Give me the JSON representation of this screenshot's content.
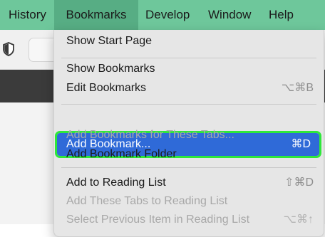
{
  "menubar": {
    "items": [
      {
        "label": "History"
      },
      {
        "label": "Bookmarks"
      },
      {
        "label": "Develop"
      },
      {
        "label": "Window"
      },
      {
        "label": "Help"
      }
    ],
    "active": "Bookmarks"
  },
  "menu": {
    "items": [
      {
        "label": "Show Start Page",
        "shortcut": "",
        "enabled": true
      },
      {
        "label": "Show Bookmarks",
        "shortcut": "",
        "enabled": true
      },
      {
        "label": "Edit Bookmarks",
        "shortcut": "⌥⌘B",
        "enabled": true
      },
      {
        "label": "Add Bookmark...",
        "shortcut": "⌘D",
        "enabled": true,
        "highlighted": true
      },
      {
        "label": "Add Bookmarks for These Tabs...",
        "shortcut": "",
        "enabled": false
      },
      {
        "label": "Add Bookmark Folder",
        "shortcut": "",
        "enabled": true
      },
      {
        "label": "Add to Reading List",
        "shortcut": "⇧⌘D",
        "enabled": true
      },
      {
        "label": "Add These Tabs to Reading List",
        "shortcut": "",
        "enabled": false
      },
      {
        "label": "Select Previous Item in Reading List",
        "shortcut": "⌥⌘↑",
        "enabled": false
      }
    ]
  },
  "icons": {
    "toolbar": "shield-icon"
  },
  "colors": {
    "menubar": "#6ec79b",
    "menubar_active": "#57ad84",
    "highlight": "#2f6ad8",
    "highlight_outline": "#2ee83a"
  }
}
